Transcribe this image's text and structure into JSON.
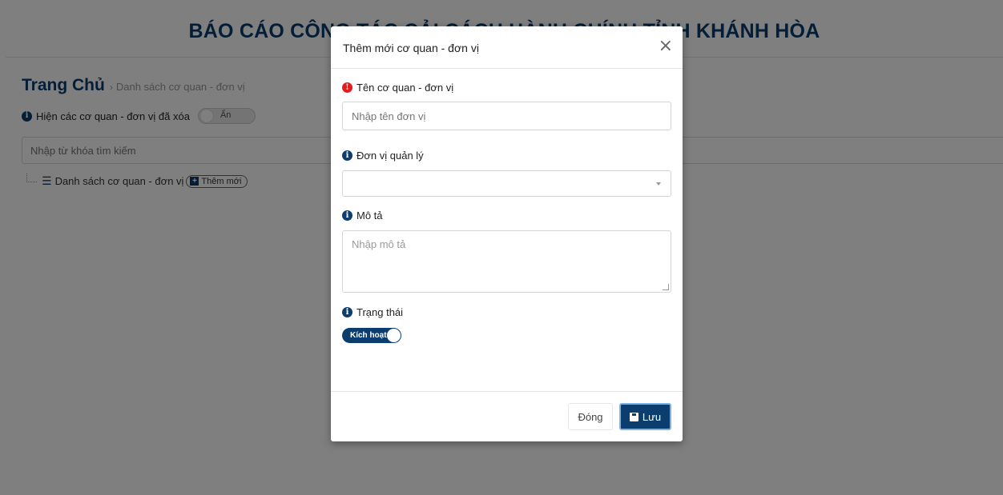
{
  "page": {
    "title": "BÁO CÁO CÔNG TÁC CẢI CÁCH HÀNH CHÍNH TỈNH KHÁNH HÒA",
    "breadcrumb": {
      "home": "Trang Chủ",
      "separator": "›",
      "current": "Danh sách cơ quan - đơn vị"
    },
    "show_deleted": {
      "label": "Hiện các cơ quan - đơn vị đã xóa",
      "toggle_label": "Ẩn"
    },
    "search": {
      "placeholder": "Nhập từ khóa tìm kiếm"
    },
    "tree": {
      "label": "Danh sách cơ quan - đơn vị",
      "add_label": "Thêm mới"
    }
  },
  "modal": {
    "title": "Thêm mới cơ quan - đơn vị",
    "close_glyph": "×",
    "fields": {
      "name": {
        "label": "Tên cơ quan - đơn vị",
        "placeholder": "Nhập tên đơn vị",
        "required": true
      },
      "parent": {
        "label": "Đơn vị quản lý",
        "value": ""
      },
      "description": {
        "label": "Mô tả",
        "placeholder": "Nhập mô tả"
      },
      "status": {
        "label": "Trạng thái",
        "toggle_label": "Kích hoạt",
        "on": true
      }
    },
    "footer": {
      "close_label": "Đóng",
      "save_label": "Lưu"
    }
  },
  "colors": {
    "brand": "#0b3d6e",
    "required": "#e01e1e",
    "overlay": "rgba(0,0,0,0.5)"
  },
  "icons": [
    "info-icon",
    "required-info-icon",
    "list-icon",
    "plus-square-icon",
    "close-icon",
    "chevron-down-icon",
    "save-icon"
  ]
}
